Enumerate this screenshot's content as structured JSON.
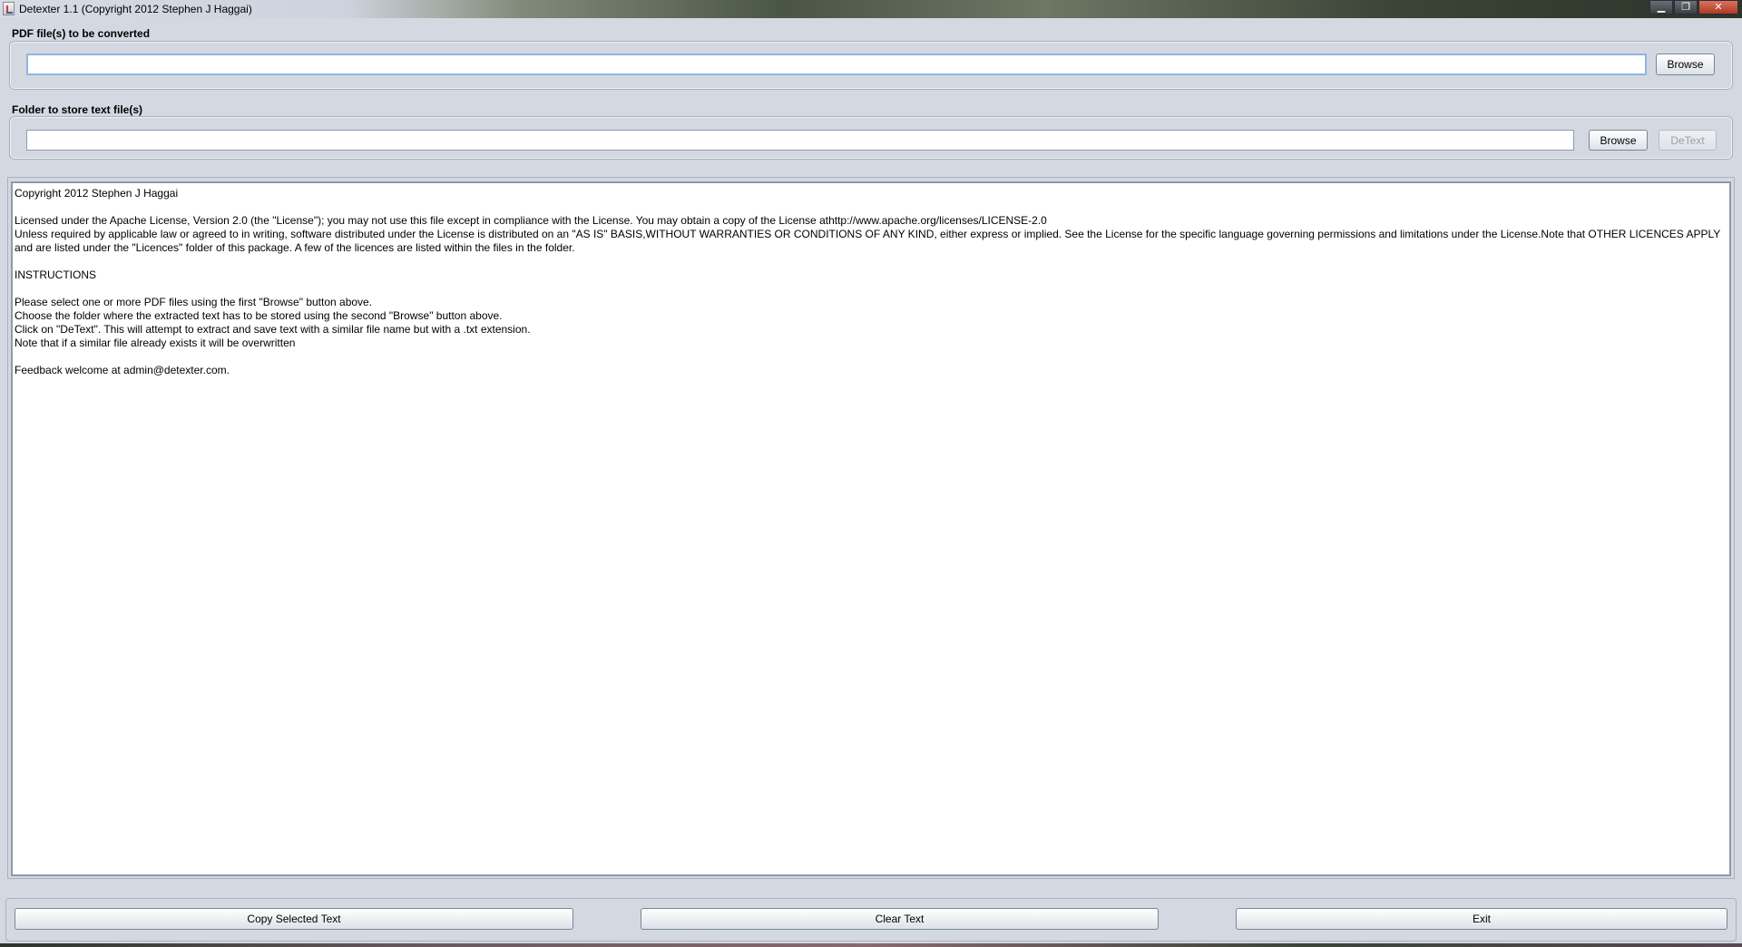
{
  "window": {
    "title": "Detexter 1.1 (Copyright 2012 Stephen J Haggai)",
    "controls": {
      "minimize": "▁",
      "maximize": "❐",
      "close": "✕"
    }
  },
  "pdf_section": {
    "label": "PDF file(s) to be converted",
    "input_value": "",
    "browse_label": "Browse"
  },
  "folder_section": {
    "label": "Folder to store text file(s)",
    "input_value": "",
    "browse_label": "Browse",
    "detext_label": "DeText"
  },
  "output_text": {
    "lines": [
      "Copyright 2012 Stephen J Haggai",
      "",
      "Licensed under the Apache License, Version 2.0 (the \"License\"); you may not use this file except in compliance with the License. You may obtain a copy of the License athttp://www.apache.org/licenses/LICENSE-2.0",
      "Unless required by applicable law or agreed to in writing, software distributed under the License is distributed on an \"AS IS\" BASIS,WITHOUT WARRANTIES OR CONDITIONS OF ANY KIND, either express or implied. See the License for the specific language governing permissions and limitations under the License.Note that OTHER LICENCES APPLY and are listed under the \"Licences\" folder of this package. A few of the licences are listed within the files in the folder.",
      "",
      "INSTRUCTIONS",
      "",
      "Please select one or more PDF files using the first \"Browse\" button above.",
      "Choose the folder where the extracted text has to be stored using the second \"Browse\" button above.",
      "Click on \"DeText\". This will attempt to extract and save text with a similar file name but with a .txt extension.",
      "Note that if a similar file already exists it will be overwritten",
      "",
      "Feedback welcome at admin@detexter.com."
    ]
  },
  "bottom_bar": {
    "copy_label": "Copy Selected Text",
    "clear_label": "Clear Text",
    "exit_label": "Exit"
  }
}
